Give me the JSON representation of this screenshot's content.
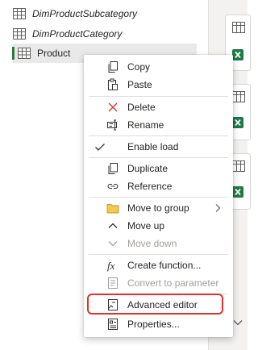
{
  "queries": [
    {
      "label": "DimProductSubcategory"
    },
    {
      "label": "DimProductCategory"
    },
    {
      "label": "Product"
    }
  ],
  "menu": {
    "copy": "Copy",
    "paste": "Paste",
    "delete": "Delete",
    "rename": "Rename",
    "enable_load": "Enable load",
    "duplicate": "Duplicate",
    "reference": "Reference",
    "move_to_group": "Move to group",
    "move_up": "Move up",
    "move_down": "Move down",
    "create_function": "Create function...",
    "convert_to_parameter": "Convert to parameter",
    "advanced_editor": "Advanced editor",
    "properties": "Properties..."
  },
  "colors": {
    "accent_green": "#2a7d3f",
    "delete_red": "#d13438",
    "highlight_red": "#e03030",
    "folder_yellow": "#f2c94c",
    "excel_green": "#1d7a45"
  }
}
